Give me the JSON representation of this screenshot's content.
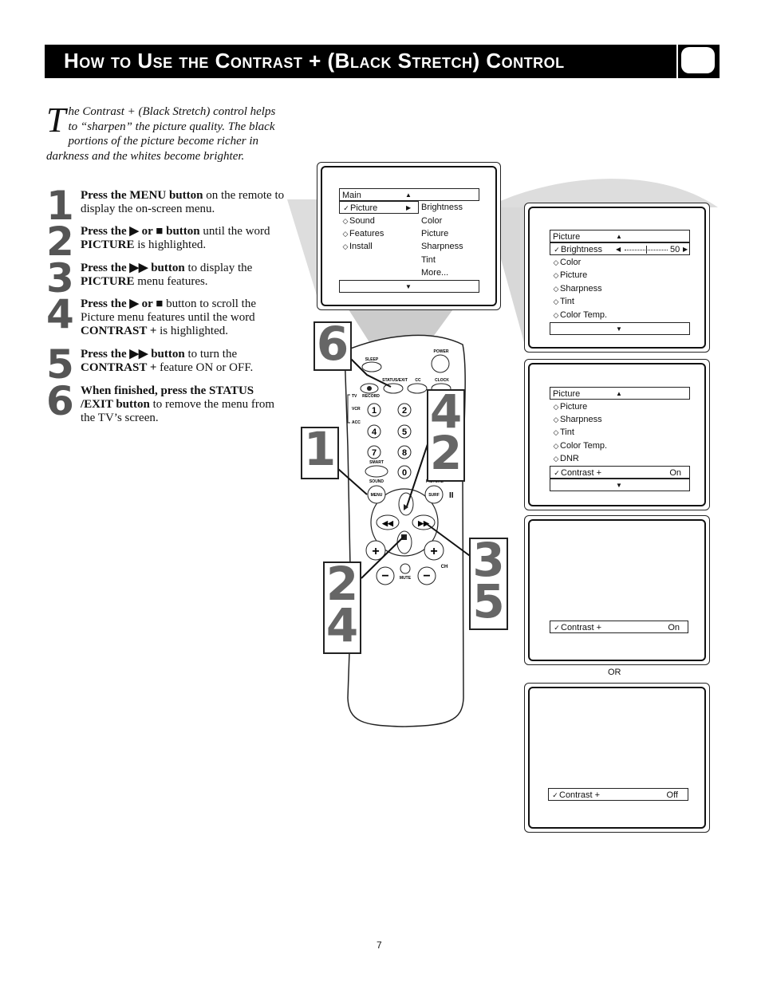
{
  "header": {
    "title": "How to Use the Contrast + (Black Stretch) Control",
    "icon": "tv-screen-icon"
  },
  "intro": {
    "drop_cap": "T",
    "text": "he Contrast + (Black Stretch) control helps to “sharpen” the picture quality. The black portions of the picture become richer in darkness and the whites become brighter."
  },
  "steps": [
    {
      "num": "1",
      "bold": "Press the MENU button",
      "rest": " on the remote to display the on-screen menu."
    },
    {
      "num": "2",
      "bold": "Press the ▶ or ■ button",
      "rest": " until the word ",
      "bold2": "PICTURE",
      "rest2": " is highlighted."
    },
    {
      "num": "3",
      "bold": "Press the ▶▶ button",
      "rest": " to display the ",
      "bold2": "PICTURE",
      "rest2": " menu features."
    },
    {
      "num": "4",
      "bold": "Press the ▶ or ■",
      "rest": " button to scroll the Picture menu features until the word ",
      "bold2": "CONTRAST +",
      "rest2": " is highlighted."
    },
    {
      "num": "5",
      "bold": "Press the ▶▶ button",
      "rest": " to turn the ",
      "bold2": "CONTRAST +",
      "rest2": " feature ON or OFF."
    },
    {
      "num": "6",
      "bold": "When finished, press the STATUS /EXIT button",
      "rest": " to remove the menu from the TV’s screen."
    }
  ],
  "screen1": {
    "header": "Main",
    "items": [
      {
        "label": "Picture",
        "icon": "check",
        "selected": true
      },
      {
        "label": "Sound",
        "icon": "diamond"
      },
      {
        "label": "Features",
        "icon": "diamond"
      },
      {
        "label": "Install",
        "icon": "diamond"
      }
    ],
    "submenu": [
      "Brightness",
      "Color",
      "Picture",
      "Sharpness",
      "Tint",
      "More..."
    ]
  },
  "screen2": {
    "header": "Picture",
    "items": [
      {
        "label": "Brightness",
        "icon": "check",
        "selected": true,
        "value": "50"
      },
      {
        "label": "Color",
        "icon": "diamond"
      },
      {
        "label": "Picture",
        "icon": "diamond"
      },
      {
        "label": "Sharpness",
        "icon": "diamond"
      },
      {
        "label": "Tint",
        "icon": "diamond"
      },
      {
        "label": "Color Temp.",
        "icon": "diamond"
      }
    ],
    "brightness_level": 0.5
  },
  "screen3": {
    "header": "Picture",
    "items": [
      {
        "label": "Picture",
        "icon": "diamond"
      },
      {
        "label": "Sharpness",
        "icon": "diamond"
      },
      {
        "label": "Tint",
        "icon": "diamond"
      },
      {
        "label": "Color Temp.",
        "icon": "diamond"
      },
      {
        "label": "DNR",
        "icon": "diamond"
      },
      {
        "label": "Contrast +",
        "icon": "check",
        "selected": true,
        "value": "On"
      }
    ]
  },
  "screen4": {
    "label": "Contrast +",
    "value": "On"
  },
  "or_label": "OR",
  "screen5": {
    "label": "Contrast +",
    "value": "Off"
  },
  "remote": {
    "labels": {
      "power": "POWER",
      "sleep": "SLEEP",
      "status_exit": "STATUS/EXIT",
      "cc": "CC",
      "clock": "CLOCK",
      "record": "RECORD",
      "tv": "TV",
      "vcr": "VCR",
      "acc": "ACC",
      "smart": "SMART",
      "sound": "SOUND",
      "picture": "PICTURE",
      "menu": "MENU",
      "surf": "SURF",
      "mute": "MUTE",
      "ch": "CH"
    },
    "digits": [
      "1",
      "2",
      "4",
      "5",
      "7",
      "8",
      "0"
    ]
  },
  "callouts": {
    "c6": "6",
    "c42": [
      "4",
      "2"
    ],
    "c1": "1",
    "c35": [
      "3",
      "5"
    ],
    "c24": [
      "2",
      "4"
    ]
  },
  "page_number": "7"
}
